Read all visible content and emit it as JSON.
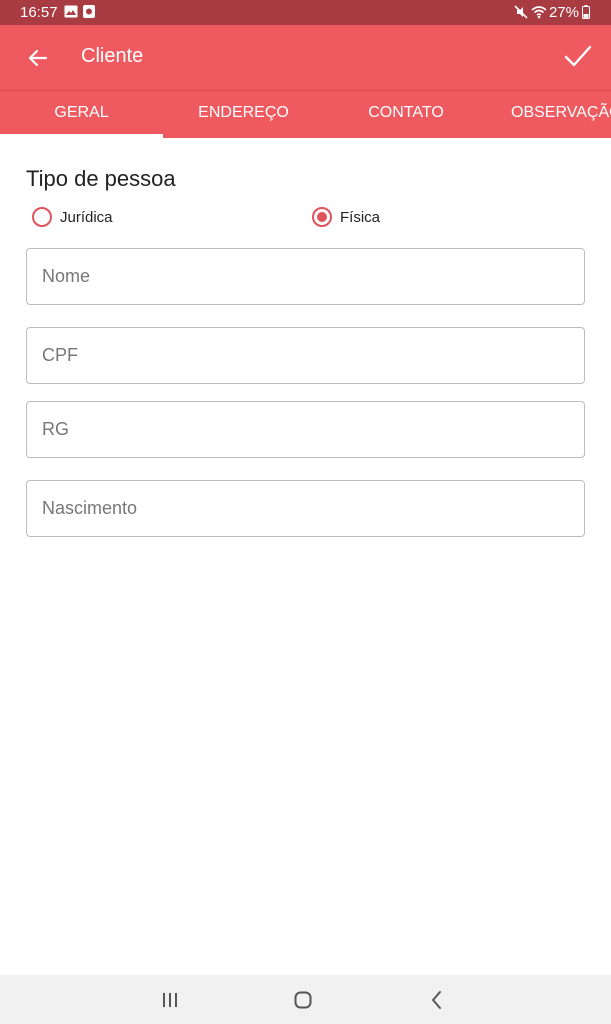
{
  "status_bar": {
    "time": "16:57",
    "battery": "27%",
    "icons": [
      "image-icon",
      "app-notification-icon",
      "mute-icon",
      "wifi-icon",
      "battery-icon"
    ]
  },
  "app_bar": {
    "title": "Cliente",
    "back_icon": "arrow-left-icon",
    "confirm_icon": "check-icon",
    "color": "#ee5a60"
  },
  "tabs": [
    {
      "label": "GERAL",
      "active": true
    },
    {
      "label": "ENDEREÇO",
      "active": false
    },
    {
      "label": "CONTATO",
      "active": false
    },
    {
      "label": "OBSERVAÇÃO",
      "active": false
    }
  ],
  "form": {
    "section_title": "Tipo de pessoa",
    "radio_options": [
      {
        "label": "Jurídica",
        "selected": false
      },
      {
        "label": "Física",
        "selected": true
      }
    ],
    "fields": [
      {
        "placeholder": "Nome",
        "value": ""
      },
      {
        "placeholder": "CPF",
        "value": ""
      },
      {
        "placeholder": "RG",
        "value": ""
      },
      {
        "placeholder": "Nascimento",
        "value": ""
      }
    ]
  },
  "nav_bar": {
    "icons": [
      "recent-apps-icon",
      "home-icon",
      "back-icon"
    ]
  },
  "colors": {
    "primary": "#ee5a60",
    "status_bar": "#a83c42",
    "accent": "#e0525a"
  }
}
